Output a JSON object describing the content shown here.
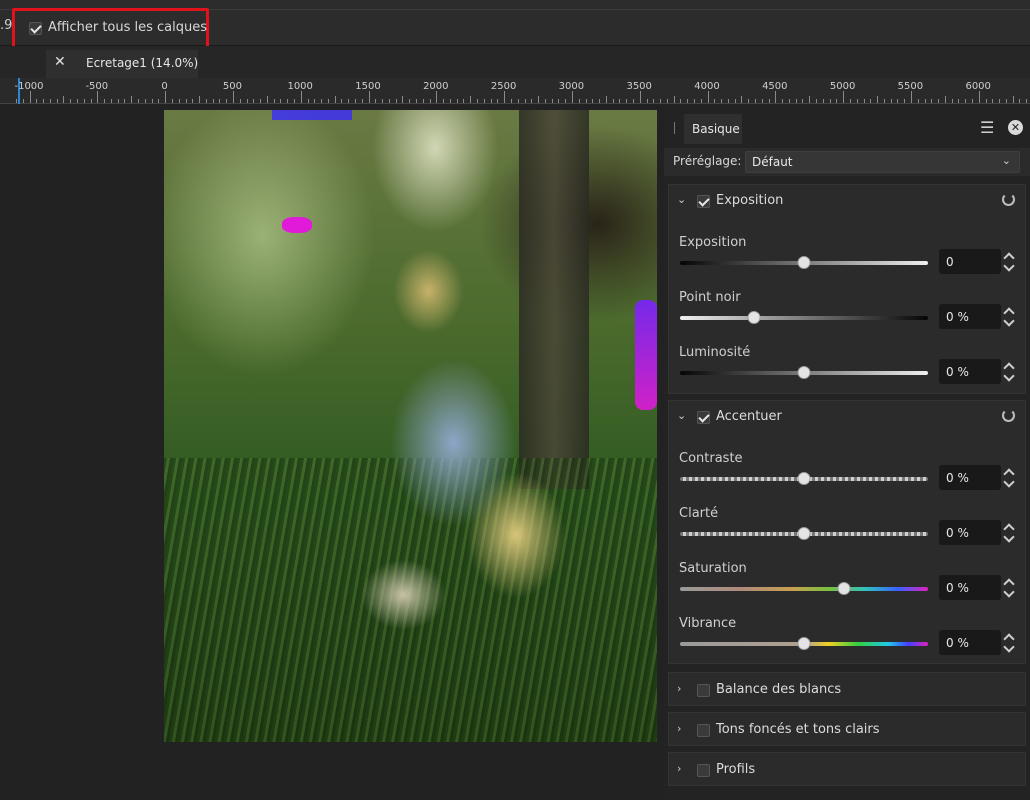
{
  "toolbar": {
    "left_number": ".9",
    "show_all_layers_label": "Afficher tous les calques",
    "show_all_layers_checked": true
  },
  "tab": {
    "close_glyph": "✕",
    "title": "Ecretage1 (14.0%)"
  },
  "ruler": {
    "labels": [
      "-1000",
      "-500",
      "0",
      "500",
      "1000",
      "1500",
      "2000",
      "2500",
      "3000",
      "3500",
      "4000",
      "4500",
      "5000",
      "5500",
      "6000"
    ]
  },
  "panel": {
    "title": "Basique",
    "menu_icon": "hamburger-icon",
    "close_icon": "close-icon",
    "preset_label": "Préréglage:",
    "preset_value": "Défaut",
    "sections": [
      {
        "name": "Exposition",
        "checked": true,
        "expanded": true,
        "sliders": [
          {
            "label": "Exposition",
            "value": "0",
            "position": 0.5
          },
          {
            "label": "Point noir",
            "value": "0 %",
            "position": 0.3
          },
          {
            "label": "Luminosité",
            "value": "0 %",
            "position": 0.5
          }
        ]
      },
      {
        "name": "Accentuer",
        "checked": true,
        "expanded": true,
        "sliders": [
          {
            "label": "Contraste",
            "value": "0 %",
            "position": 0.5
          },
          {
            "label": "Clarté",
            "value": "0 %",
            "position": 0.5
          },
          {
            "label": "Saturation",
            "value": "0 %",
            "position": 0.66
          },
          {
            "label": "Vibrance",
            "value": "0 %",
            "position": 0.5
          }
        ]
      }
    ],
    "collapsed_sections": [
      {
        "name": "Balance des blancs",
        "checked": false
      },
      {
        "name": "Tons foncés et tons clairs",
        "checked": false
      },
      {
        "name": "Profils",
        "checked": false
      }
    ]
  },
  "colors": {
    "highlight_box": "#e0121b",
    "ruler_cursor": "#2a87d8"
  }
}
